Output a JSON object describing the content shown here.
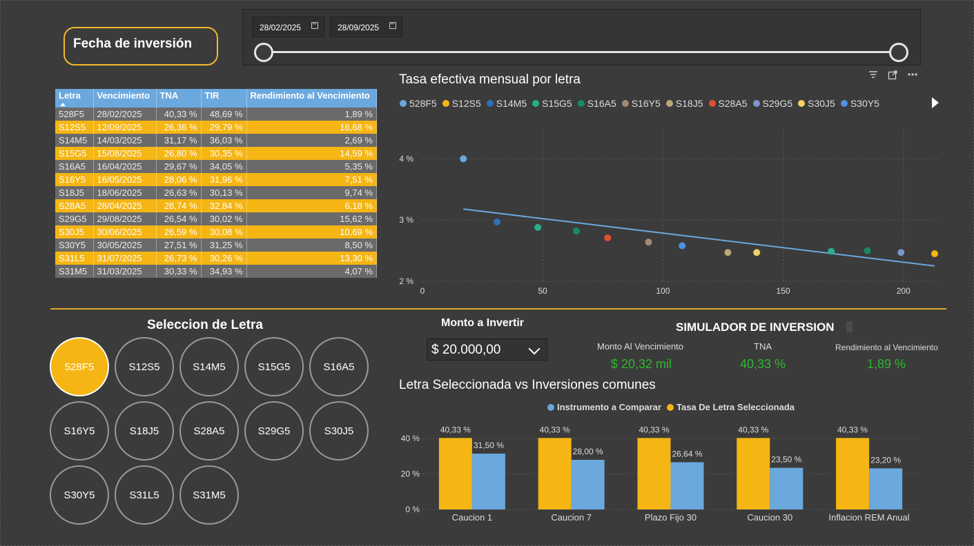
{
  "header": {
    "fecha_label": "Fecha de inversión",
    "date_start": "28/02/2025",
    "date_end": "28/09/2025"
  },
  "table": {
    "columns": [
      "Letra",
      "Vencimiento",
      "TNA",
      "TIR",
      "Rendimiento al Vencimiento"
    ],
    "rows": [
      [
        "528F5",
        "28/02/2025",
        "40,33 %",
        "48,69 %",
        "1,89 %"
      ],
      [
        "S12S5",
        "12/09/2025",
        "26,36 %",
        "29,79 %",
        "16,68 %"
      ],
      [
        "S14M5",
        "14/03/2025",
        "31,17 %",
        "36,03 %",
        "2,69 %"
      ],
      [
        "S15G5",
        "15/08/2025",
        "26,80 %",
        "30,35 %",
        "14,59 %"
      ],
      [
        "S16A5",
        "16/04/2025",
        "29,67 %",
        "34,05 %",
        "5,35 %"
      ],
      [
        "S16Y5",
        "16/05/2025",
        "28,06 %",
        "31,96 %",
        "7,51 %"
      ],
      [
        "S18J5",
        "18/06/2025",
        "26,63 %",
        "30,13 %",
        "9,74 %"
      ],
      [
        "S28A5",
        "28/04/2025",
        "28,74 %",
        "32,84 %",
        "6,18 %"
      ],
      [
        "S29G5",
        "29/08/2025",
        "26,54 %",
        "30,02 %",
        "15,62 %"
      ],
      [
        "S30J5",
        "30/06/2025",
        "26,59 %",
        "30,08 %",
        "10,69 %"
      ],
      [
        "S30Y5",
        "30/05/2025",
        "27,51 %",
        "31,25 %",
        "8,50 %"
      ],
      [
        "S31L5",
        "31/07/2025",
        "26,73 %",
        "30,26 %",
        "13,30 %"
      ],
      [
        "S31M5",
        "31/03/2025",
        "30,33 %",
        "34,93 %",
        "4,07 %"
      ]
    ]
  },
  "scatter": {
    "title": "Tasa efectiva mensual por letra",
    "legend": [
      {
        "name": "528F5",
        "color": "#6ba8de"
      },
      {
        "name": "S12S5",
        "color": "#f5b513"
      },
      {
        "name": "S14M5",
        "color": "#2f6fb8"
      },
      {
        "name": "S15G5",
        "color": "#24b08a"
      },
      {
        "name": "S16A5",
        "color": "#168a6a"
      },
      {
        "name": "S16Y5",
        "color": "#a08a70"
      },
      {
        "name": "S18J5",
        "color": "#b8a878"
      },
      {
        "name": "S28A5",
        "color": "#e0502e"
      },
      {
        "name": "S29G5",
        "color": "#7a96cc"
      },
      {
        "name": "S30J5",
        "color": "#f0d060"
      },
      {
        "name": "S30Y5",
        "color": "#4f8fe6"
      }
    ]
  },
  "chart_data": [
    {
      "type": "scatter",
      "title": "Tasa efectiva mensual por letra",
      "xlabel": "",
      "ylabel": "",
      "xlim": [
        0,
        215
      ],
      "ylim": [
        2,
        4.5
      ],
      "x_ticks": [
        "0",
        "50",
        "100",
        "150",
        "200"
      ],
      "y_ticks": [
        "2 %",
        "3 %",
        "4 %"
      ],
      "points": [
        {
          "x": 17,
          "y": 4.0,
          "color": "#6ba8de"
        },
        {
          "x": 31,
          "y": 2.97,
          "color": "#2f6fb8"
        },
        {
          "x": 48,
          "y": 2.88,
          "color": "#24b08a"
        },
        {
          "x": 64,
          "y": 2.82,
          "color": "#168a6a"
        },
        {
          "x": 77,
          "y": 2.71,
          "color": "#e0502e"
        },
        {
          "x": 94,
          "y": 2.64,
          "color": "#a08a70"
        },
        {
          "x": 108,
          "y": 2.58,
          "color": "#4f8fe6"
        },
        {
          "x": 127,
          "y": 2.47,
          "color": "#b8a878"
        },
        {
          "x": 139,
          "y": 2.47,
          "color": "#f0d060"
        },
        {
          "x": 170,
          "y": 2.49,
          "color": "#24b08a"
        },
        {
          "x": 185,
          "y": 2.5,
          "color": "#168a6a"
        },
        {
          "x": 199,
          "y": 2.47,
          "color": "#7a96cc"
        },
        {
          "x": 213,
          "y": 2.45,
          "color": "#f5b513"
        }
      ],
      "trendline": {
        "x": [
          17,
          213
        ],
        "y": [
          3.18,
          2.25
        ],
        "color": "#6ba8de"
      }
    },
    {
      "type": "bar",
      "title": "Letra Seleccionada vs Inversiones comunes",
      "categories": [
        "Caucion 1",
        "Caucion 7",
        "Plazo Fijo 30",
        "Caucion 30",
        "Inflacion REM Anual"
      ],
      "series": [
        {
          "name": "Tasa De Letra Seleccionada",
          "color": "#f5b513",
          "values": [
            40.33,
            40.33,
            40.33,
            40.33,
            40.33
          ],
          "labels": [
            "40,33 %",
            "40,33 %",
            "40,33 %",
            "40,33 %",
            "40,33 %"
          ]
        },
        {
          "name": "Instrumento a Comparar",
          "color": "#6ba8de",
          "values": [
            31.5,
            28.0,
            26.64,
            23.5,
            23.2
          ],
          "labels": [
            "31,50 %",
            "28,00 %",
            "26,64 %",
            "23,50 %",
            "23,20 %"
          ]
        }
      ],
      "ylim": [
        0,
        42
      ],
      "y_ticks": [
        "0 %",
        "20 %",
        "40 %"
      ]
    }
  ],
  "selection": {
    "title": "Seleccion de Letra",
    "letters": [
      "528F5",
      "S12S5",
      "S14M5",
      "S15G5",
      "S16A5",
      "S16Y5",
      "S18J5",
      "S28A5",
      "S29G5",
      "S30J5",
      "S30Y5",
      "S31L5",
      "S31M5"
    ],
    "active": "528F5"
  },
  "monto": {
    "title": "Monto a Invertir",
    "value": "$ 20.000,00"
  },
  "simulator": {
    "title": "SIMULADOR DE INVERSION",
    "kpi1_label": "Monto Al Vencimiento",
    "kpi1_value": "$ 20,32 mil",
    "kpi2_label": "TNA",
    "kpi2_value": "40,33 %",
    "kpi3_label": "Rendimiento al Vencimiento",
    "kpi3_value": "1,89 %"
  },
  "bars": {
    "title": "Letra Seleccionada vs Inversiones comunes",
    "legend": [
      {
        "name": "Instrumento a Comparar",
        "color": "#6ba8de"
      },
      {
        "name": "Tasa De Letra Seleccionada",
        "color": "#f5b513"
      }
    ]
  }
}
